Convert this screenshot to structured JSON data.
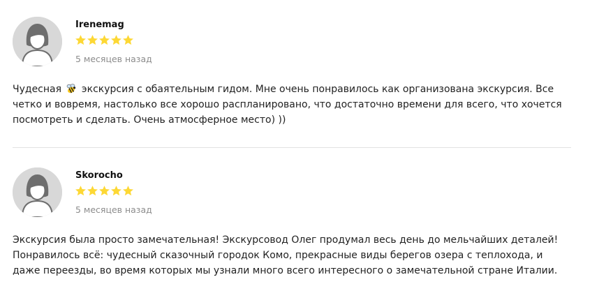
{
  "reviews": [
    {
      "author": "Irenemag",
      "rating": 5,
      "rating_max": 5,
      "date": "5 месяцев назад",
      "text_before_icon": "Чудесная ",
      "inline_icon": "bee-icon",
      "text_after_icon": " экскурсия с обаятельным гидом. Мне очень понравилось как организована экскурсия. Все четко и вовремя, настолько все хорошо распланировано, что достаточно времени для всего, что хочется посмотреть и сделать. Очень атмосферное место) ))"
    },
    {
      "author": "Skorocho",
      "rating": 5,
      "rating_max": 5,
      "date": "5 месяцев назад",
      "text": "Экскурсия была просто замечательная! Экскурсовод Олег продумал весь день до мельчайших деталей! Понравилось всё: чудесный сказочный городок Комо, прекрасные виды берегов озера с теплохода, и даже переезды, во время которых мы узнали много всего интересного о замечательной стране Италии."
    }
  ],
  "colors": {
    "star": "#fdd835",
    "avatar_bg": "#d8d8d8",
    "avatar_figure": "#ffffff",
    "date": "#8c8c8c",
    "divider": "#e2e2e2"
  },
  "icons": {
    "avatar": "user-placeholder-icon",
    "star": "star-icon"
  }
}
